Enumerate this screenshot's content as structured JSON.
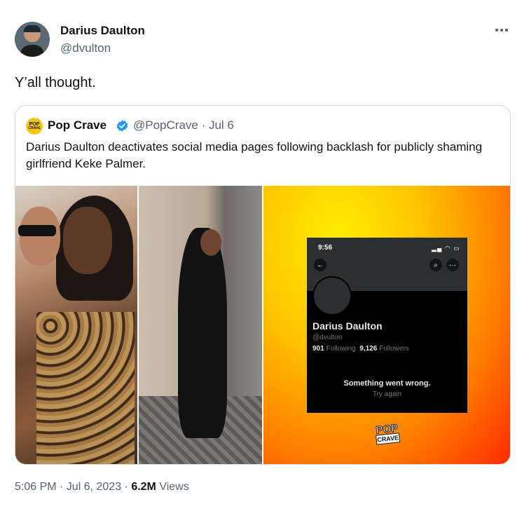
{
  "author": {
    "name": "Darius Daulton",
    "handle": "@dvulton"
  },
  "tweet_text": "Y’all thought.",
  "quoted": {
    "logo_lines": [
      "POP",
      "CRAVE"
    ],
    "name": "Pop Crave",
    "handle_date": "@PopCrave · Jul 6",
    "text": "Darius Daulton deactivates social media pages following backlash for publicly shaming girlfriend Keke Palmer.",
    "media_screenshot": {
      "time": "9:56",
      "profile_name": "Darius Daulton",
      "profile_handle": "@dvulton",
      "following_count": "901",
      "following_label": "Following",
      "followers_count": "9,126",
      "followers_label": "Followers",
      "error_title": "Something went wrong.",
      "error_action": "Try again",
      "brand_logo": [
        "POP",
        "CRAVE"
      ]
    }
  },
  "meta": {
    "time_date": "5:06 PM · Jul 6, 2023 · ",
    "views_count": "6.2M",
    "views_label": " Views"
  },
  "colors": {
    "text_primary": "#0f1419",
    "text_secondary": "#536471",
    "verified_blue": "#1d9bf0",
    "border": "#cfd9de"
  },
  "icons": [
    "more-icon",
    "verified-badge-icon",
    "back-arrow-icon",
    "search-icon",
    "overflow-icon"
  ]
}
